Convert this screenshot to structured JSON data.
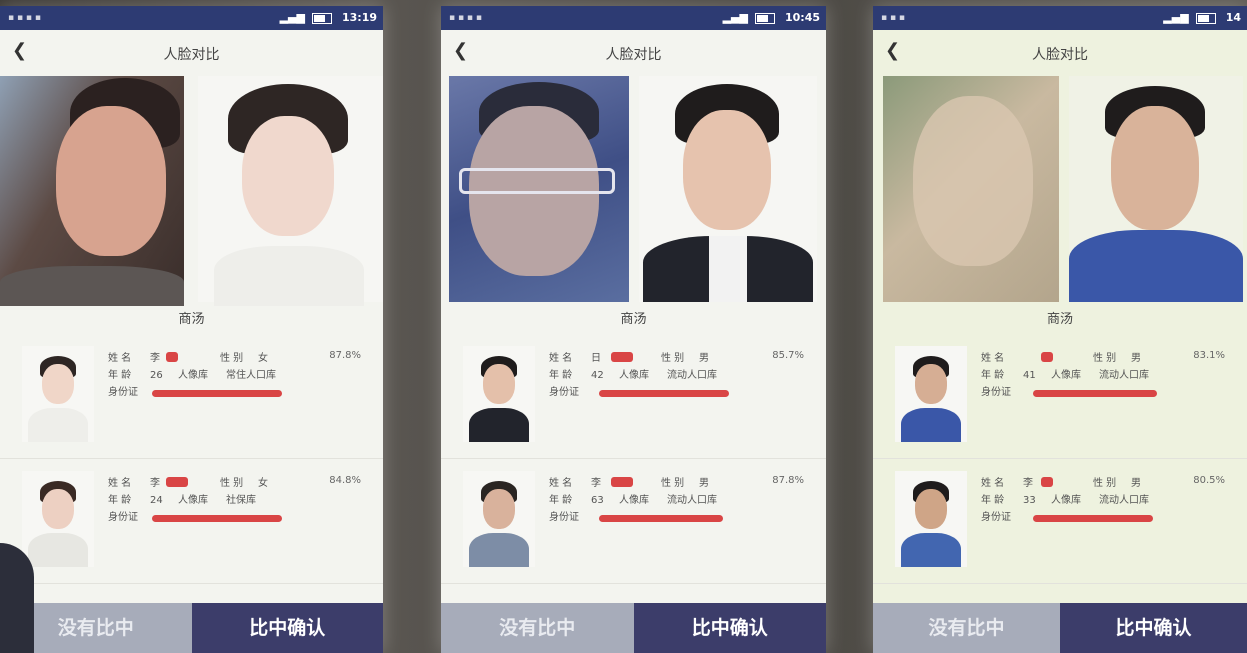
{
  "phones": [
    {
      "status_time": "13:19",
      "title": "人脸对比",
      "section": "商汤",
      "results": [
        {
          "name_label": "姓 名",
          "name_value": "李",
          "gender_label": "性 别",
          "gender_value": "女",
          "age_label": "年 龄",
          "age_value": "26",
          "db_label": "人像库",
          "db_value": "常住人口库",
          "id_label": "身份证",
          "score": "87.8%"
        },
        {
          "name_label": "姓 名",
          "name_value": "李",
          "gender_label": "性 别",
          "gender_value": "女",
          "age_label": "年 龄",
          "age_value": "24",
          "db_label": "人像库",
          "db_value": "社保库",
          "id_label": "身份证",
          "score": "84.8%"
        }
      ],
      "btn_no": "没有比中",
      "btn_yes": "比中确认"
    },
    {
      "status_time": "10:45",
      "title": "人脸对比",
      "section": "商汤",
      "results": [
        {
          "name_label": "姓 名",
          "name_value": "日",
          "gender_label": "性 别",
          "gender_value": "男",
          "age_label": "年 龄",
          "age_value": "42",
          "db_label": "人像库",
          "db_value": "流动人口库",
          "id_label": "身份证",
          "score": "85.7%"
        },
        {
          "name_label": "姓 名",
          "name_value": "李",
          "gender_label": "性 别",
          "gender_value": "男",
          "age_label": "年 龄",
          "age_value": "63",
          "db_label": "人像库",
          "db_value": "流动人口库",
          "id_label": "身份证",
          "score": "87.8%"
        }
      ],
      "btn_no": "没有比中",
      "btn_yes": "比中确认"
    },
    {
      "status_time": "14",
      "title": "人脸对比",
      "section": "商汤",
      "results": [
        {
          "name_label": "姓 名",
          "name_value": "",
          "gender_label": "性 别",
          "gender_value": "男",
          "age_label": "年 龄",
          "age_value": "41",
          "db_label": "人像库",
          "db_value": "流动人口库",
          "id_label": "身份证",
          "score": "83.1%"
        },
        {
          "name_label": "姓 名",
          "name_value": "李",
          "gender_label": "性 别",
          "gender_value": "男",
          "age_label": "年 龄",
          "age_value": "33",
          "db_label": "人像库",
          "db_value": "流动人口库",
          "id_label": "身份证",
          "score": "80.5%"
        }
      ],
      "btn_no": "没有比中",
      "btn_yes": "比中确认"
    }
  ],
  "colors": {
    "status_bar": "#2d3b73",
    "confirm_button": "#3c3d6a",
    "reject_button": "#a7acba",
    "redaction": "#d94545"
  },
  "icons": [
    "back-arrow-icon",
    "signal-icon",
    "wifi-icon",
    "battery-icon"
  ]
}
